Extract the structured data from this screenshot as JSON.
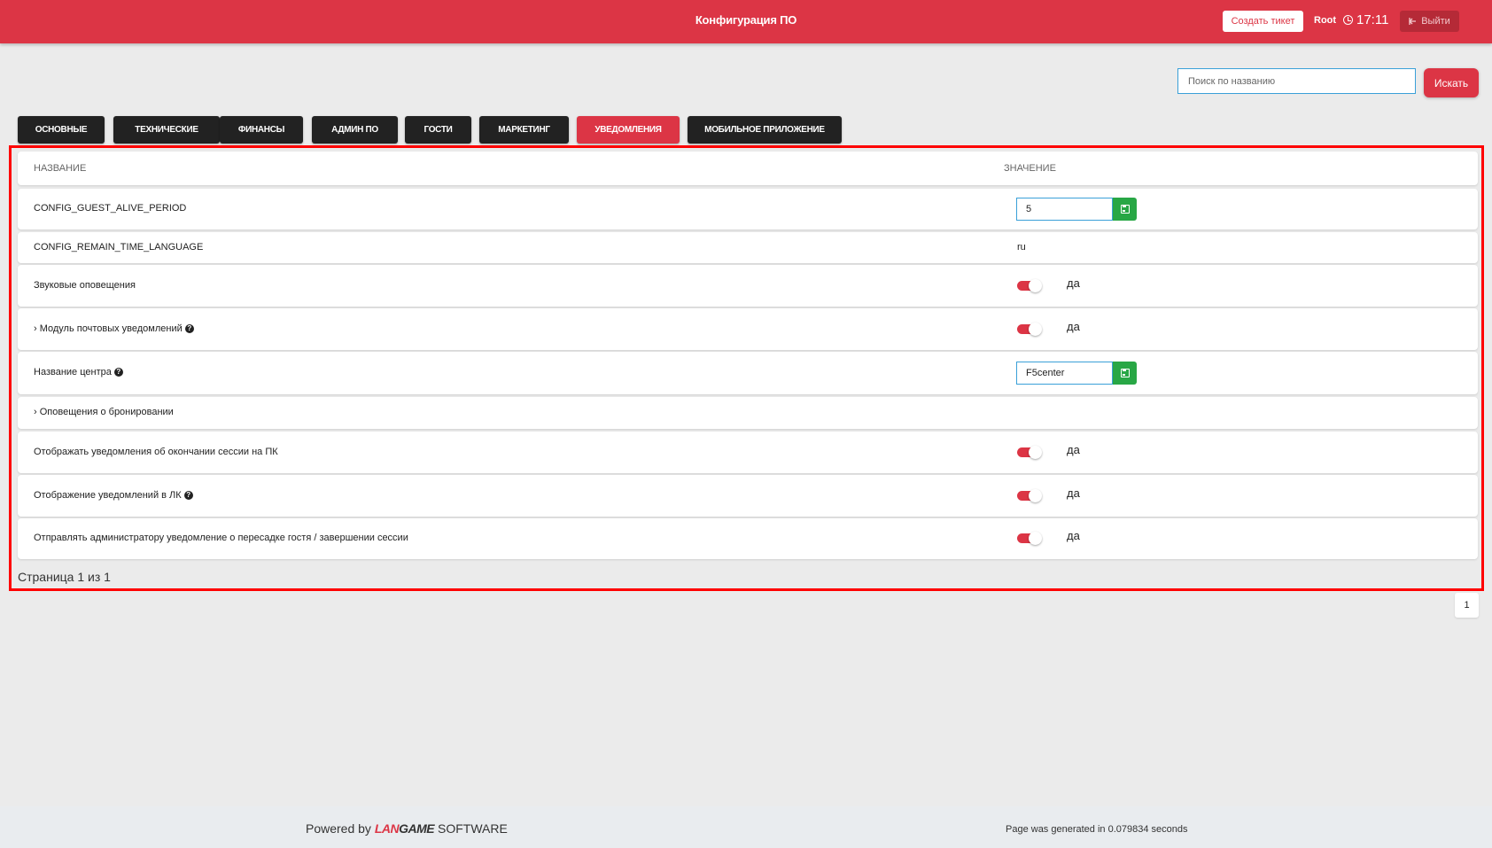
{
  "header": {
    "title": "Конфигурация ПО",
    "create_ticket": "Создать тикет",
    "user": "Root",
    "time": "17:11",
    "logout": "Выйти",
    "brand_color": "#dc3545"
  },
  "search": {
    "placeholder": "Поиск по названию",
    "button": "Искать"
  },
  "tabs": [
    {
      "label": "ОСНОВНЫЕ",
      "active": false
    },
    {
      "label": "ТЕХНИЧЕСКИЕ",
      "active": false
    },
    {
      "label": "ФИНАНСЫ",
      "active": false
    },
    {
      "label": "АДМИН ПО",
      "active": false
    },
    {
      "label": "ГОСТИ",
      "active": false
    },
    {
      "label": "МАРКЕТИНГ",
      "active": false
    },
    {
      "label": "УВЕДОМЛЕНИЯ",
      "active": true
    },
    {
      "label": "МОБИЛЬНОЕ ПРИЛОЖЕНИЕ",
      "active": false
    }
  ],
  "table": {
    "col_name": "НАЗВАНИЕ",
    "col_value": "ЗНАЧЕНИЕ",
    "rows": [
      {
        "name": "CONFIG_GUEST_ALIVE_PERIOD",
        "type": "input",
        "value": "5"
      },
      {
        "name": "CONFIG_REMAIN_TIME_LANGUAGE",
        "type": "text",
        "value": "ru"
      },
      {
        "name": "Звуковые оповещения",
        "type": "toggle",
        "value": "да",
        "checked": true
      },
      {
        "name": "› Модуль почтовых уведомлений",
        "type": "toggle",
        "value": "да",
        "checked": true,
        "help": true
      },
      {
        "name": "Название центра",
        "type": "input",
        "value": "F5center",
        "help": true
      },
      {
        "name": "› Оповещения о бронировании",
        "type": "none",
        "value": ""
      },
      {
        "name": "Отображать уведомления об окончании сессии на ПК",
        "type": "toggle",
        "value": "да",
        "checked": true
      },
      {
        "name": "Отображение уведомлений в ЛК",
        "type": "toggle",
        "value": "да",
        "checked": true,
        "help": true
      },
      {
        "name": "Отправлять администратору уведомление о пересадке гостя / завершении сессии",
        "type": "toggle",
        "value": "да",
        "checked": true
      }
    ]
  },
  "pagination": {
    "summary": "Страница 1 из 1",
    "current": "1"
  },
  "footer": {
    "powered_by": "Powered by",
    "brand_lan": "LAN",
    "brand_game": "GAME",
    "brand_software": "SOFTWARE",
    "generated": "Page was generated in 0.079834 seconds"
  }
}
